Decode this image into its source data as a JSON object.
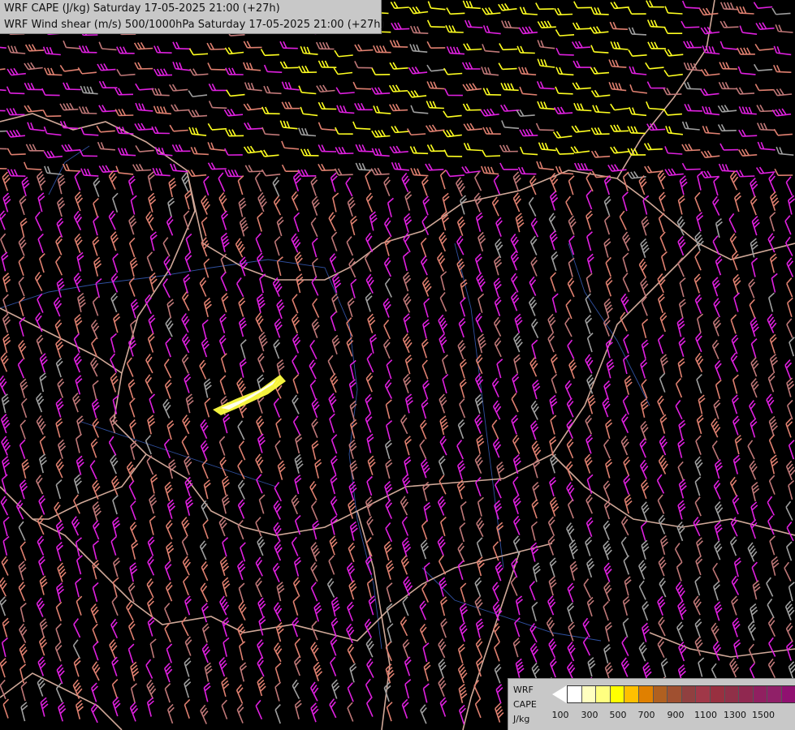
{
  "title": {
    "line1": "WRF CAPE (J/kg) Saturday 17-05-2025 21:00 (+27h)",
    "line2": "WRF Wind shear (m/s) 500/1000hPa Saturday 17-05-2025 21:00 (+27h)"
  },
  "legend": {
    "label_line1": "WRF",
    "label_line2": "CAPE",
    "label_line3": "J/kg",
    "colors": [
      "#ffffff",
      "#ffffc0",
      "#ffff80",
      "#ffff00",
      "#ffc000",
      "#e08000",
      "#b06020",
      "#a05030",
      "#904040",
      "#a03848",
      "#983040",
      "#903048",
      "#902850",
      "#902060",
      "#902068",
      "#901070",
      "#900878",
      "#800070"
    ],
    "tick_labels": [
      "100",
      "300",
      "500",
      "700",
      "900",
      "1100",
      "1300",
      "1500"
    ]
  },
  "map_colors": {
    "background": "#000000",
    "barb_magenta": "#e020e0",
    "barb_salmon": "#e08070",
    "barb_rose": "#c07878",
    "barb_yellow": "#ffff20",
    "barb_grey": "#a0a0a0",
    "border": "#d0a898",
    "river": "#3050a0"
  }
}
